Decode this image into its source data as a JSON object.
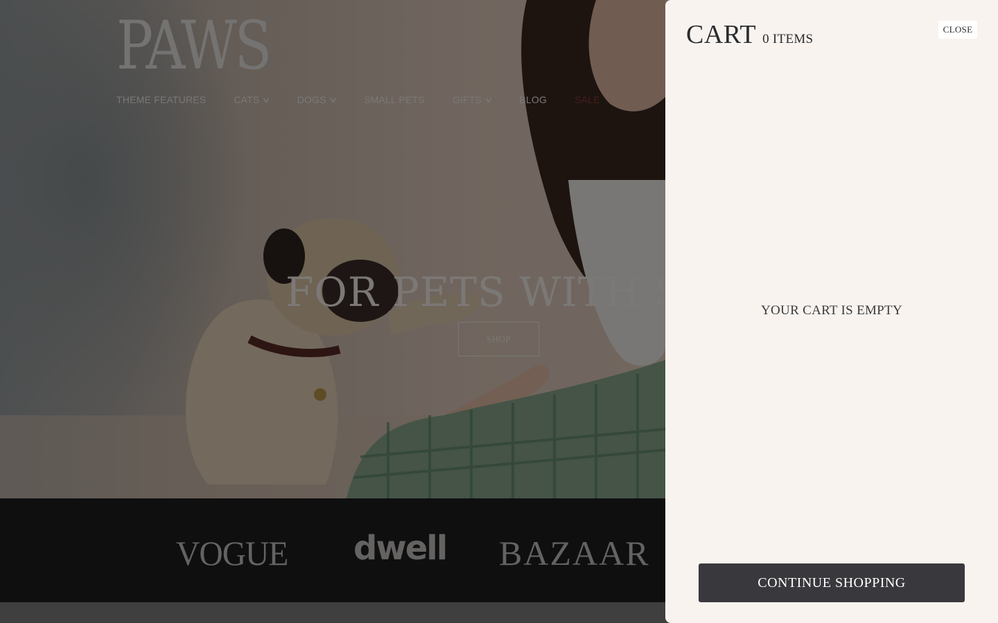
{
  "brand": {
    "logo_text": "PAWS"
  },
  "nav": {
    "items": [
      {
        "label": "THEME FEATURES",
        "dropdown": false
      },
      {
        "label": "CATS",
        "dropdown": true
      },
      {
        "label": "DOGS",
        "dropdown": true
      },
      {
        "label": "SMALL PETS",
        "dropdown": false
      },
      {
        "label": "GIFTS",
        "dropdown": true
      },
      {
        "label": "BLOG",
        "dropdown": false
      },
      {
        "label": "SALE",
        "dropdown": false
      }
    ],
    "chevron_glyph": "∨"
  },
  "hero": {
    "headline": "FOR PETS WITH STY",
    "cta_label": "SHOP"
  },
  "press": {
    "logos": [
      "VOGUE",
      "dwell",
      "BAZAAR"
    ]
  },
  "cart": {
    "title": "CART",
    "item_count": "0 ITEMS",
    "close_label": "CLOSE",
    "empty_message": "YOUR CART IS EMPTY",
    "continue_label": "CONTINUE SHOPPING"
  },
  "colors": {
    "drawer_bg": "#f8f3ef",
    "button_dark": "#39383c",
    "press_bg": "#1f1f21",
    "sale_accent": "#8a3b3b"
  }
}
